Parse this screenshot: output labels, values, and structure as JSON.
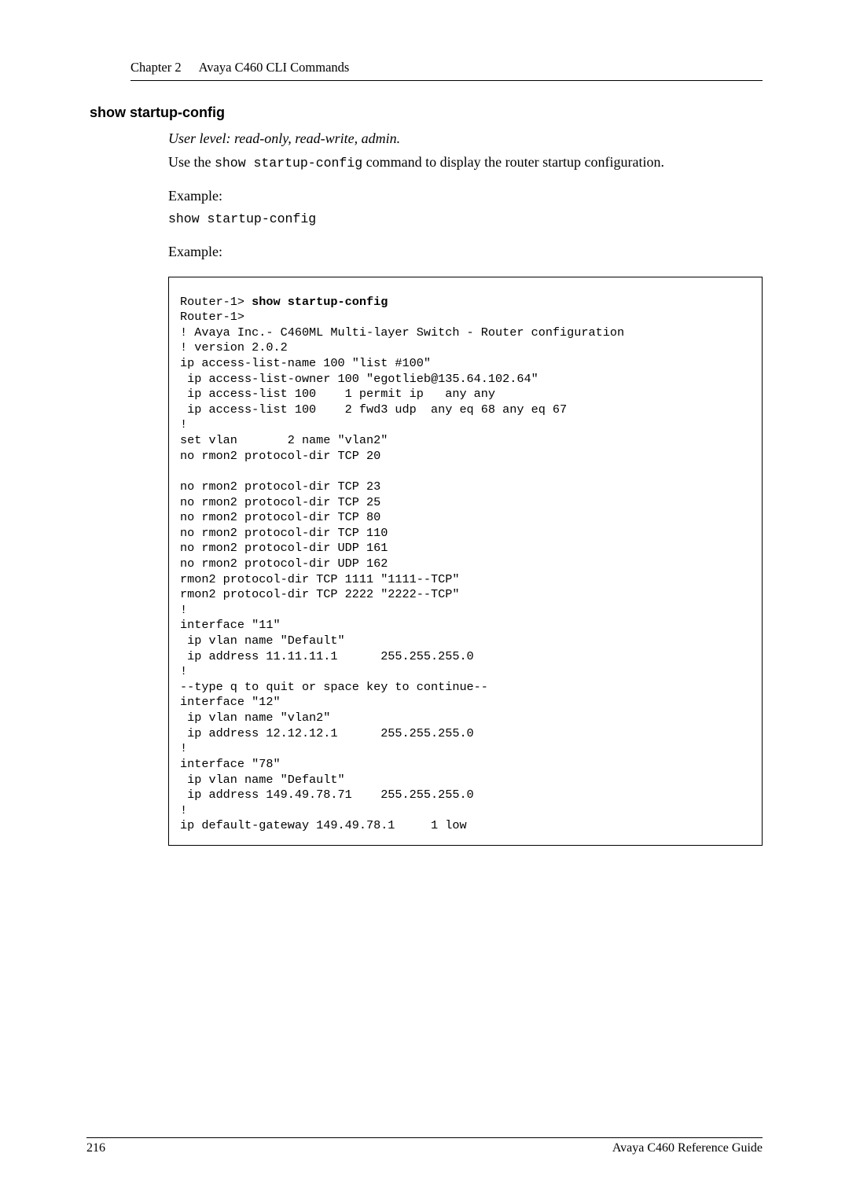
{
  "header": {
    "chapter_label": "Chapter 2",
    "chapter_title": "Avaya C460 CLI Commands"
  },
  "section": {
    "heading": "show startup-config",
    "user_level": "User level: read-only, read-write, admin.",
    "usage_pre": "Use the ",
    "usage_cmd": "show startup-config",
    "usage_post": " command to display the router startup configuration.",
    "example1_label": "Example:",
    "example1_cmd": "show startup-config",
    "example2_label": "Example:"
  },
  "cli": {
    "prompt": "Router-1> ",
    "command": "show startup-config",
    "body": "Router-1>\n! Avaya Inc.- C460ML Multi-layer Switch - Router configuration\n! version 2.0.2\nip access-list-name 100 \"list #100\"\n ip access-list-owner 100 \"egotlieb@135.64.102.64\"\n ip access-list 100    1 permit ip   any any\n ip access-list 100    2 fwd3 udp  any eq 68 any eq 67\n!\nset vlan       2 name \"vlan2\"\nno rmon2 protocol-dir TCP 20\n\nno rmon2 protocol-dir TCP 23\nno rmon2 protocol-dir TCP 25\nno rmon2 protocol-dir TCP 80\nno rmon2 protocol-dir TCP 110\nno rmon2 protocol-dir UDP 161\nno rmon2 protocol-dir UDP 162\nrmon2 protocol-dir TCP 1111 \"1111--TCP\"\nrmon2 protocol-dir TCP 2222 \"2222--TCP\"\n!\ninterface \"11\"\n ip vlan name \"Default\"\n ip address 11.11.11.1      255.255.255.0\n!\n--type q to quit or space key to continue--\ninterface \"12\"\n ip vlan name \"vlan2\"\n ip address 12.12.12.1      255.255.255.0\n!\ninterface \"78\"\n ip vlan name \"Default\"\n ip address 149.49.78.71    255.255.255.0\n!\nip default-gateway 149.49.78.1     1 low"
  },
  "footer": {
    "page": "216",
    "doc": "Avaya C460 Reference Guide"
  }
}
